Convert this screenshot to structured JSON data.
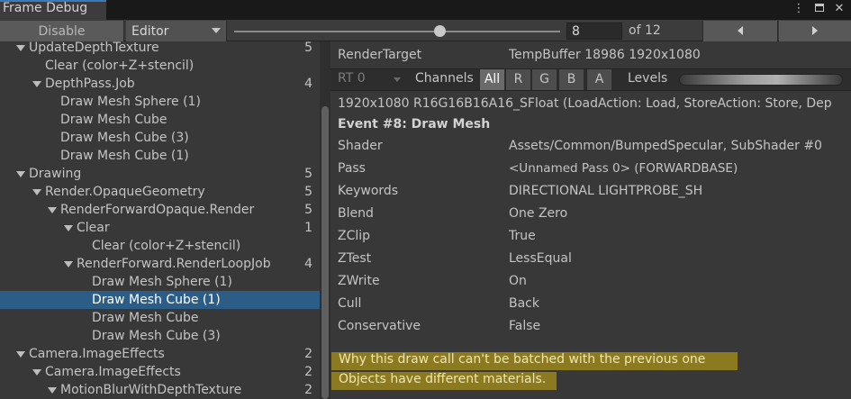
{
  "window": {
    "tab_title": "Frame Debug",
    "menu_icon": "kebab-icon",
    "maximize_icon": "maximize-icon",
    "close_icon": "close-icon"
  },
  "toolbar": {
    "disable_label": "Disable",
    "target_dropdown": "Editor",
    "current_event": "8",
    "total_events_label": "of 12",
    "prev_icon": "triangle-left-icon",
    "next_icon": "triangle-right-icon"
  },
  "tree": {
    "rows": [
      {
        "label": "UpdateDepthTexture",
        "count": "5",
        "expanded": true
      },
      {
        "label": "Clear (color+Z+stencil)",
        "count": ""
      },
      {
        "label": "DepthPass.Job",
        "count": "4",
        "expanded": true
      },
      {
        "label": "Draw Mesh Sphere (1)",
        "count": ""
      },
      {
        "label": "Draw Mesh Cube",
        "count": ""
      },
      {
        "label": "Draw Mesh Cube (3)",
        "count": ""
      },
      {
        "label": "Draw Mesh Cube (1)",
        "count": ""
      },
      {
        "label": "Drawing",
        "count": "5",
        "expanded": true
      },
      {
        "label": "Render.OpaqueGeometry",
        "count": "5",
        "expanded": true
      },
      {
        "label": "RenderForwardOpaque.Render",
        "count": "5",
        "expanded": true
      },
      {
        "label": "Clear",
        "count": "1",
        "expanded": true
      },
      {
        "label": "Clear (color+Z+stencil)",
        "count": ""
      },
      {
        "label": "RenderForward.RenderLoopJob",
        "count": "4",
        "expanded": true
      },
      {
        "label": "Draw Mesh Sphere (1)",
        "count": ""
      },
      {
        "label": "Draw Mesh Cube (1)",
        "count": "",
        "selected": true
      },
      {
        "label": "Draw Mesh Cube",
        "count": ""
      },
      {
        "label": "Draw Mesh Cube (3)",
        "count": ""
      },
      {
        "label": "Camera.ImageEffects",
        "count": "2",
        "expanded": true
      },
      {
        "label": "Camera.ImageEffects",
        "count": "2",
        "expanded": true
      },
      {
        "label": "MotionBlurWithDepthTexture",
        "count": "2",
        "expanded": true
      }
    ]
  },
  "details": {
    "render_target_label": "RenderTarget",
    "render_target_value": "TempBuffer 18986 1920x1080",
    "rt_dropdown": "RT 0",
    "channels_label": "Channels",
    "channels": [
      "All",
      "R",
      "G",
      "B",
      "A"
    ],
    "active_channel": "All",
    "levels_label": "Levels",
    "format_line": "1920x1080 R16G16B16A16_SFloat (LoadAction: Load, StoreAction: Store, Dep",
    "event_title": "Event #8: Draw Mesh",
    "properties": [
      {
        "key": "Shader",
        "value": "Assets/Common/BumpedSpecular, SubShader #0"
      },
      {
        "key": "Pass",
        "value": "<Unnamed Pass 0> (FORWARDBASE)"
      },
      {
        "key": "Keywords",
        "value": "DIRECTIONAL LIGHTPROBE_SH"
      },
      {
        "key": "Blend",
        "value": "One Zero"
      },
      {
        "key": "ZClip",
        "value": "True"
      },
      {
        "key": "ZTest",
        "value": "LessEqual"
      },
      {
        "key": "ZWrite",
        "value": "On"
      },
      {
        "key": "Cull",
        "value": "Back"
      },
      {
        "key": "Conservative",
        "value": "False"
      }
    ],
    "batch_title": "Why this draw call can't be batched with the previous one",
    "batch_reason": "Objects have different materials."
  },
  "colors": {
    "selection": "#2c5d87",
    "highlight": "#8b7a20",
    "tab_accent": "#3a79bb"
  }
}
